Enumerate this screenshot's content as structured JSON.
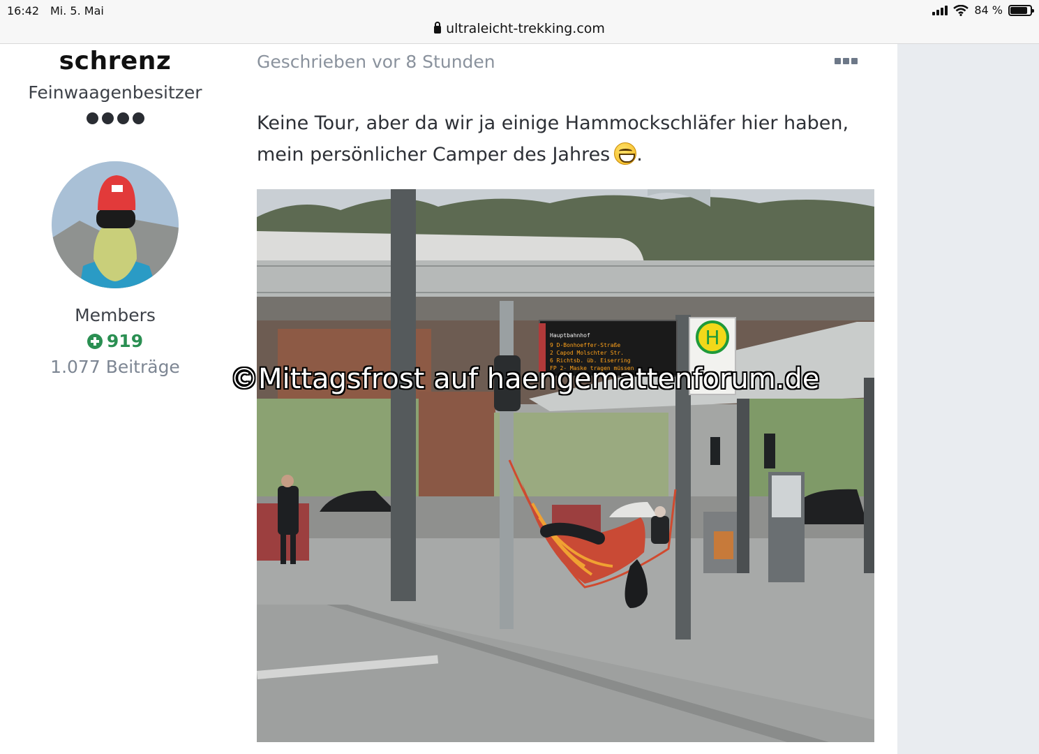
{
  "status_bar": {
    "time": "16:42",
    "date": "Mi. 5. Mai",
    "battery_percent_label": "84 %",
    "battery_level": 0.84,
    "icons": [
      "signal-icon",
      "wifi-icon",
      "battery-icon"
    ]
  },
  "browser": {
    "url": "ultraleicht-trekking.com",
    "icons": [
      "lock-icon"
    ]
  },
  "author": {
    "name": "schrenz",
    "title": "Feinwaagenbesitzer",
    "rank_dots": 4,
    "group": "Members",
    "reputation": "919",
    "posts": "1.077 Beiträge",
    "icons": [
      "avatar",
      "plus-icon"
    ]
  },
  "post": {
    "meta": "Geschrieben vor 8 Stunden",
    "text_line1": "Keine Tour, aber da wir ja einige Hammockschläfer hier haben,",
    "text_line2": "mein persönlicher Camper des Jahres",
    "text_end": ".",
    "icons": [
      "more-icon",
      "grinning-emoji-icon"
    ]
  },
  "photo": {
    "display_board_header": "Hauptbahnhof",
    "display_board_lines": [
      "9 D-Bonhoeffer-Straße",
      "2 Capod Molschter Str.",
      "6 Richtsb. üb. Eiserring",
      "FP 2- Maske tragen müssen"
    ],
    "stop_sign_letter": "H",
    "watermark": "©Mittagsfrost auf haengemattenforum.de"
  },
  "colors": {
    "reputation_green": "#2a8f52",
    "meta_grey": "#8a929d",
    "gutter": "#e9ecf0"
  }
}
